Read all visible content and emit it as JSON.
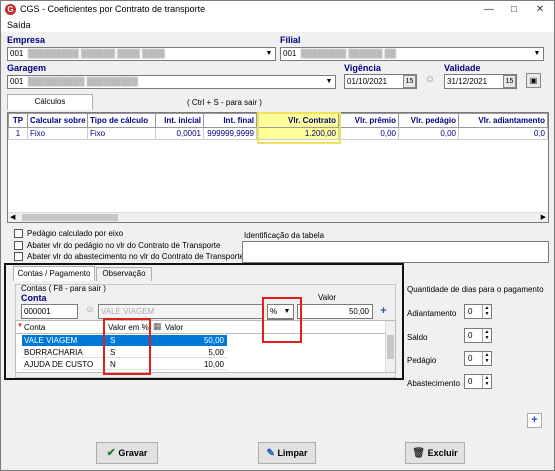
{
  "window": {
    "title": "CGS - Coeficientes por Contrato de transporte"
  },
  "menu": {
    "saida": "Saída"
  },
  "header": {
    "empresa_label": "Empresa",
    "empresa_code": "001",
    "filial_label": "Filial",
    "filial_code": "001",
    "garagem_label": "Garagem",
    "garagem_code": "001",
    "vigencia_label": "Vigência",
    "vigencia_value": "01/10/2021",
    "validade_label": "Validade",
    "validade_value": "31/12/2021"
  },
  "tabs_top": {
    "calculos": "Cálculos",
    "hint": "( Ctrl + S - para sair )"
  },
  "calc_grid": {
    "columns": [
      "TP",
      "Calcular sobre",
      "Tipo de cálculo",
      "Int. inicial",
      "Int. final",
      "Vlr. Contrato",
      "Vlr. prêmio",
      "Vlr. pedágio",
      "Vlr. adiantamento"
    ],
    "row": [
      "1",
      "Fixo",
      "Fixo",
      "0,0001",
      "999999,9999",
      "1.200,00",
      "0,00",
      "0,00",
      "0,0"
    ]
  },
  "options": {
    "pedagio_eixo": "Pedágio calculado por eixo",
    "abater_pedagio": "Abater vlr do pedágio no vlr do Contrato de Transporte",
    "abater_abastecimento": "Abater vlr do abastecimento no vlr do Contrato de Transporte",
    "identificacao_label": "Identificação da tabela"
  },
  "tabs_bottom": {
    "contas": "Contas / Pagamento",
    "observacao": "Observação"
  },
  "contas": {
    "group_label": "Contas ( F8 - para sair )",
    "conta_label": "Conta",
    "conta_code": "000001",
    "conta_desc": "VALE VIAGEM",
    "percent_selected": "%",
    "percent_options": [
      "$",
      "%"
    ],
    "valor_label": "Valor",
    "valor_value": "50,00",
    "columns": [
      "Conta",
      "Valor em %",
      "Valor"
    ],
    "rows": [
      {
        "conta": "VALE VIAGEM",
        "pct": "S",
        "valor": "50,00"
      },
      {
        "conta": "BORRACHARIA",
        "pct": "S",
        "valor": "5,00"
      },
      {
        "conta": "AJUDA DE CUSTO",
        "pct": "N",
        "valor": "10,00"
      }
    ]
  },
  "dias": {
    "title": "Quantidade de dias para o pagamento",
    "adiantamento": "Adiantamento",
    "adiantamento_val": "0",
    "saldo": "Saldo",
    "saldo_val": "0",
    "pedagio": "Pedágio",
    "pedagio_val": "0",
    "abastecimento": "Abastecimento",
    "abastecimento_val": "0"
  },
  "buttons": {
    "gravar": "Gravar",
    "limpar": "Limpar",
    "excluir": "Excluir"
  },
  "colors": {
    "highlight": "#ffff99",
    "selection": "#0078d7",
    "annotation": "#e0201c"
  }
}
